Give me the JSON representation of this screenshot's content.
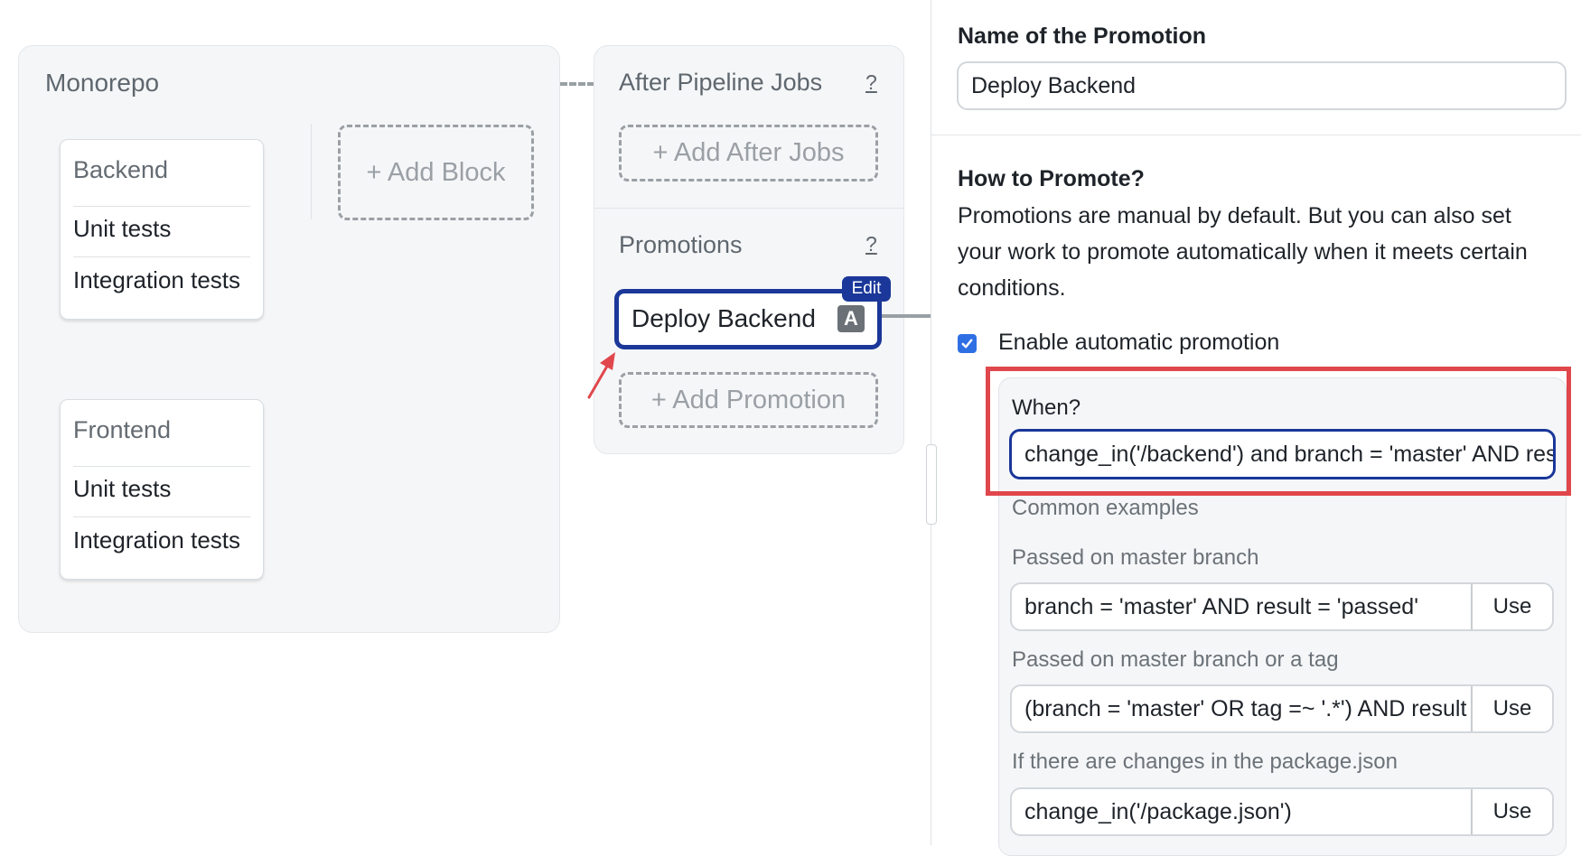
{
  "canvas": {
    "stage": {
      "title": "Monorepo",
      "add_block_label": "+ Add Block",
      "blocks": [
        {
          "title": "Backend",
          "jobs": [
            "Unit tests",
            "Integration tests"
          ]
        },
        {
          "title": "Frontend",
          "jobs": [
            "Unit tests",
            "Integration tests"
          ]
        }
      ]
    },
    "after_pipeline": {
      "title": "After Pipeline Jobs",
      "help": "?",
      "add_label": "+ Add After Jobs"
    },
    "promotions": {
      "title": "Promotions",
      "help": "?",
      "items": [
        {
          "name": "Deploy Backend",
          "badge": "A",
          "edit_label": "Edit"
        }
      ],
      "add_label": "+ Add Promotion"
    },
    "annotation_arrow_color": "#e0474c"
  },
  "editor": {
    "name_label": "Name of the Promotion",
    "name_value": "Deploy Backend",
    "how_title": "How to Promote?",
    "how_description": "Promotions are manual by default. But you can also set your work to promote automatically when it meets certain conditions.",
    "auto_promotion": {
      "label": "Enable automatic promotion",
      "checked": true
    },
    "when": {
      "label": "When?",
      "value": "change_in('/backend') and branch = 'master' AND result = 'passed'"
    },
    "examples_title": "Common examples",
    "examples": [
      {
        "title": "Passed on master branch",
        "value": "branch = 'master' AND result = 'passed'",
        "button": "Use"
      },
      {
        "title": "Passed on master branch or a tag",
        "value": "(branch = 'master' OR tag =~ '.*') AND result = 'passed'",
        "button": "Use"
      },
      {
        "title": "If there are changes in the package.json",
        "value": "change_in('/package.json')",
        "button": "Use"
      }
    ]
  },
  "colors": {
    "accent_blue": "#1a3799",
    "checkbox_blue": "#2f6fe4",
    "highlight_red": "#e0474c"
  }
}
